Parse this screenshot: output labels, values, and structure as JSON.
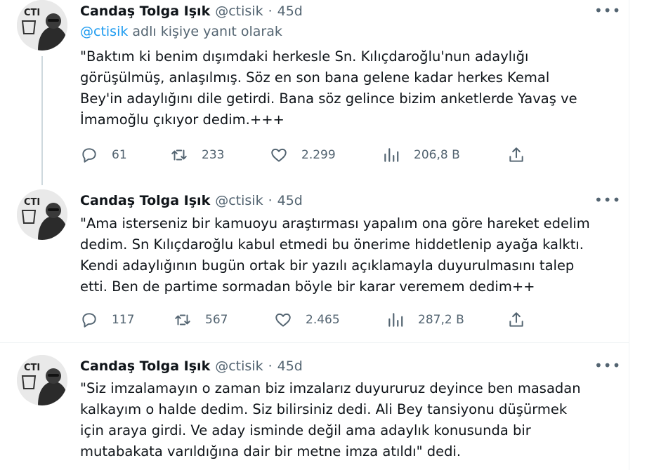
{
  "tweets": [
    {
      "author_name": "Candaş Tolga Işık",
      "author_handle": "@ctisik",
      "time": "45d",
      "reply_to_mention": "@ctisik",
      "reply_to_suffix": "adlı kişiye yanıt olarak",
      "text_lines": [
        "\"Baktım ki benim dışımdaki herkesle Sn. Kılıçdaroğlu'nun adaylığı",
        "görüşülmüş, anlaşılmış. Söz en son bana gelene kadar herkes Kemal",
        "Bey'in adaylığını dile getirdi. Bana söz gelince bizim anketlerde Yavaş ve",
        "İmamoğlu çıkıyor dedim.+++"
      ],
      "replies": "61",
      "retweets": "233",
      "likes": "2.299",
      "views": "206,8 B"
    },
    {
      "author_name": "Candaş Tolga Işık",
      "author_handle": "@ctisik",
      "time": "45d",
      "text_lines": [
        "\"Ama isterseniz bir kamuoyu araştırması yapalım ona göre hareket edelim",
        "dedim. Sn Kılıçdaroğlu kabul etmedi bu önerime hiddetlenip ayağa kalktı.",
        "Kendi adaylığının bugün ortak bir yazılı açıklamayla duyurulmasını talep",
        "etti. Ben de partime sormadan böyle bir karar veremem dedim++"
      ],
      "replies": "117",
      "retweets": "567",
      "likes": "2.465",
      "views": "287,2 B"
    },
    {
      "author_name": "Candaş Tolga Işık",
      "author_handle": "@ctisik",
      "time": "45d",
      "text_lines": [
        "\"Siz imzalamayın o zaman biz imzalarız duyururuz deyince ben masadan",
        "kalkayım o halde dedim. Siz bilirsiniz dedi. Ali Bey tansiyonu düşürmek",
        "için araya girdi. Ve aday isminde değil ama adaylık konusunda bir",
        "mutabakata varıldığına dair bir metne imza atıldı\" dedi."
      ]
    }
  ],
  "ui": {
    "separator_dot": "·",
    "more_glyph": "•••",
    "avatar_text": "CTI"
  },
  "colors": {
    "text": "#0f1419",
    "secondary": "#536471",
    "link": "#1d9bf0",
    "divider": "#eff3f4"
  },
  "icons": [
    "reply-icon",
    "retweet-icon",
    "like-icon",
    "views-icon",
    "share-icon",
    "more-icon"
  ]
}
